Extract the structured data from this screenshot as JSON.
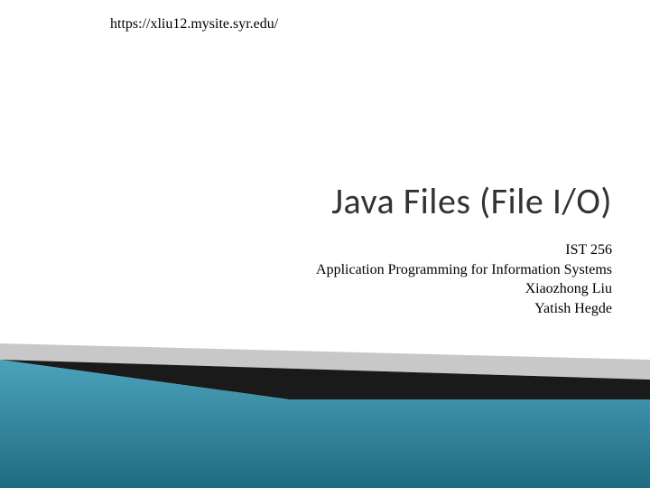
{
  "header": {
    "url": "https://xliu12.mysite.syr.edu/"
  },
  "slide": {
    "title": "Java Files (File I/O)",
    "course_code": "IST 256",
    "course_name": "Application Programming for Information Systems",
    "author1": "Xiaozhong Liu",
    "author2": "Yatish Hegde"
  },
  "colors": {
    "teal": "#2b7d95",
    "dark": "#1a1a1a",
    "gray": "#999999"
  }
}
